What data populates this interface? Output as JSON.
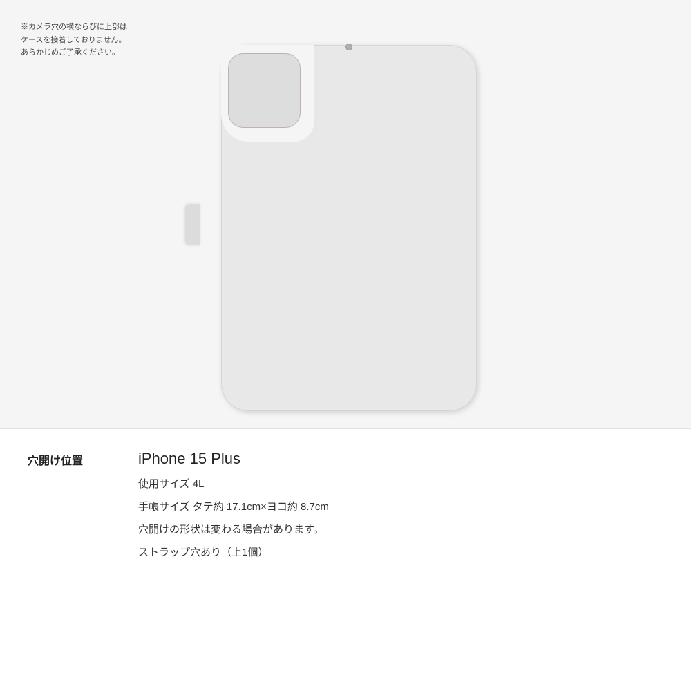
{
  "note": {
    "lines": [
      "※カメラ穴の横ならびに上部は",
      "ケースを接着しておりません。",
      "あらかじめご了承ください。"
    ]
  },
  "info": {
    "label": "穴開け位置",
    "device_name": "iPhone 15 Plus",
    "lines": [
      {
        "key": "使用サイズ",
        "value": "4L"
      },
      {
        "key": "手帳サイズ",
        "value": "タテ約 17.1cm×ヨコ約 8.7cm"
      },
      {
        "key": "穴開けの形状",
        "value": "は変わる場合があります。"
      },
      {
        "key": "ストラップ穴あり",
        "value": "（上1個）"
      }
    ],
    "detail1": "使用サイズ 4L",
    "detail2": "手帳サイズ タテ約 17.1cm×ヨコ約 8.7cm",
    "detail3": "穴開けの形状は変わる場合があります。",
    "detail4": "ストラップ穴あり（上1個）"
  },
  "colors": {
    "background": "#f5f5f5",
    "case_body": "#e8e8e8",
    "text_primary": "#222222",
    "text_secondary": "#444444"
  }
}
